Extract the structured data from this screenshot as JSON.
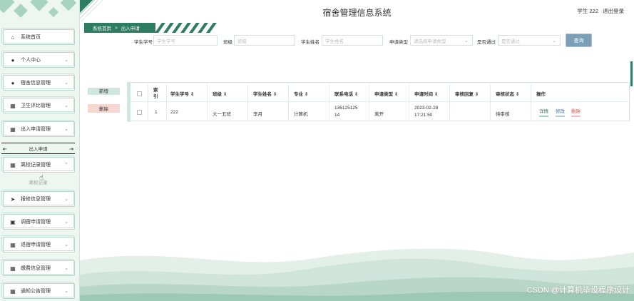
{
  "header": {
    "title": "宿舍管理信息系统",
    "user_text": "学生 222",
    "logout": "退出登录"
  },
  "breadcrumb": {
    "home": "系统首页",
    "separator": ">",
    "current": "出入申请"
  },
  "sidebar": {
    "items": [
      {
        "label": "系统首页",
        "icon": "home-icon",
        "glyph": "⌂"
      },
      {
        "label": "个人中心",
        "icon": "user-icon",
        "glyph": "●"
      },
      {
        "label": "宿舍信息管理",
        "icon": "user-icon",
        "glyph": "●"
      },
      {
        "label": "卫生评比管理",
        "icon": "grid-icon",
        "glyph": "▦"
      },
      {
        "label": "出入申请管理",
        "icon": "grid-icon",
        "glyph": "▦"
      },
      {
        "label": "离校记录管理",
        "icon": "grid-icon",
        "glyph": "▦"
      },
      {
        "label": "报修信息管理",
        "icon": "send-icon",
        "glyph": "➤"
      },
      {
        "label": "调宿申请管理",
        "icon": "clipboard-icon",
        "glyph": "▣"
      },
      {
        "label": "退宿申请管理",
        "icon": "grid-icon",
        "glyph": "▦"
      },
      {
        "label": "缴费信息管理",
        "icon": "grid-icon",
        "glyph": "▦"
      },
      {
        "label": "通知公告管理",
        "icon": "grid-icon",
        "glyph": "▦"
      }
    ],
    "sub_items": [
      {
        "label": "出入申请"
      },
      {
        "label": "离校记录"
      }
    ]
  },
  "search": {
    "student_no": {
      "label": "学生学号",
      "placeholder": "学生学号"
    },
    "class": {
      "label": "班级",
      "placeholder": "班级"
    },
    "student_name": {
      "label": "学生姓名",
      "placeholder": "学生姓名"
    },
    "apply_type": {
      "label": "申请类型",
      "placeholder": "请选择申请类型"
    },
    "approved": {
      "label": "是否通过",
      "placeholder": "是否通过"
    },
    "button": "查询"
  },
  "actions": {
    "add": "新增",
    "delete": "删除"
  },
  "table": {
    "headers": [
      "索引",
      "学生学号",
      "班级",
      "学生姓名",
      "专业",
      "联系电话",
      "申请类型",
      "申请时间",
      "审核回复",
      "审核状态",
      "操作"
    ],
    "rows": [
      {
        "index": "1",
        "student_no": "222",
        "class": "大一五班",
        "name": "李月",
        "major": "计算机",
        "phone_l1": "136125125",
        "phone_l2": "14",
        "type": "离开",
        "time_date": "2023-02-28",
        "time_clock": "17:21:50",
        "reply": "",
        "status": "待审核",
        "ops": {
          "detail": "详情",
          "edit": "修改",
          "del": "删除"
        }
      }
    ],
    "sort_glyph": "⇕",
    "index_l1": "索",
    "index_l2": "引"
  },
  "watermark": "CSDN @计算机毕设程序设计",
  "colors": {
    "accent": "#2e7d62",
    "sidebar_bg": "#eef6f2",
    "query_btn": "#7a9fb7",
    "delete_bg": "#f6d7cf",
    "add_bg": "#cfe6dc"
  }
}
